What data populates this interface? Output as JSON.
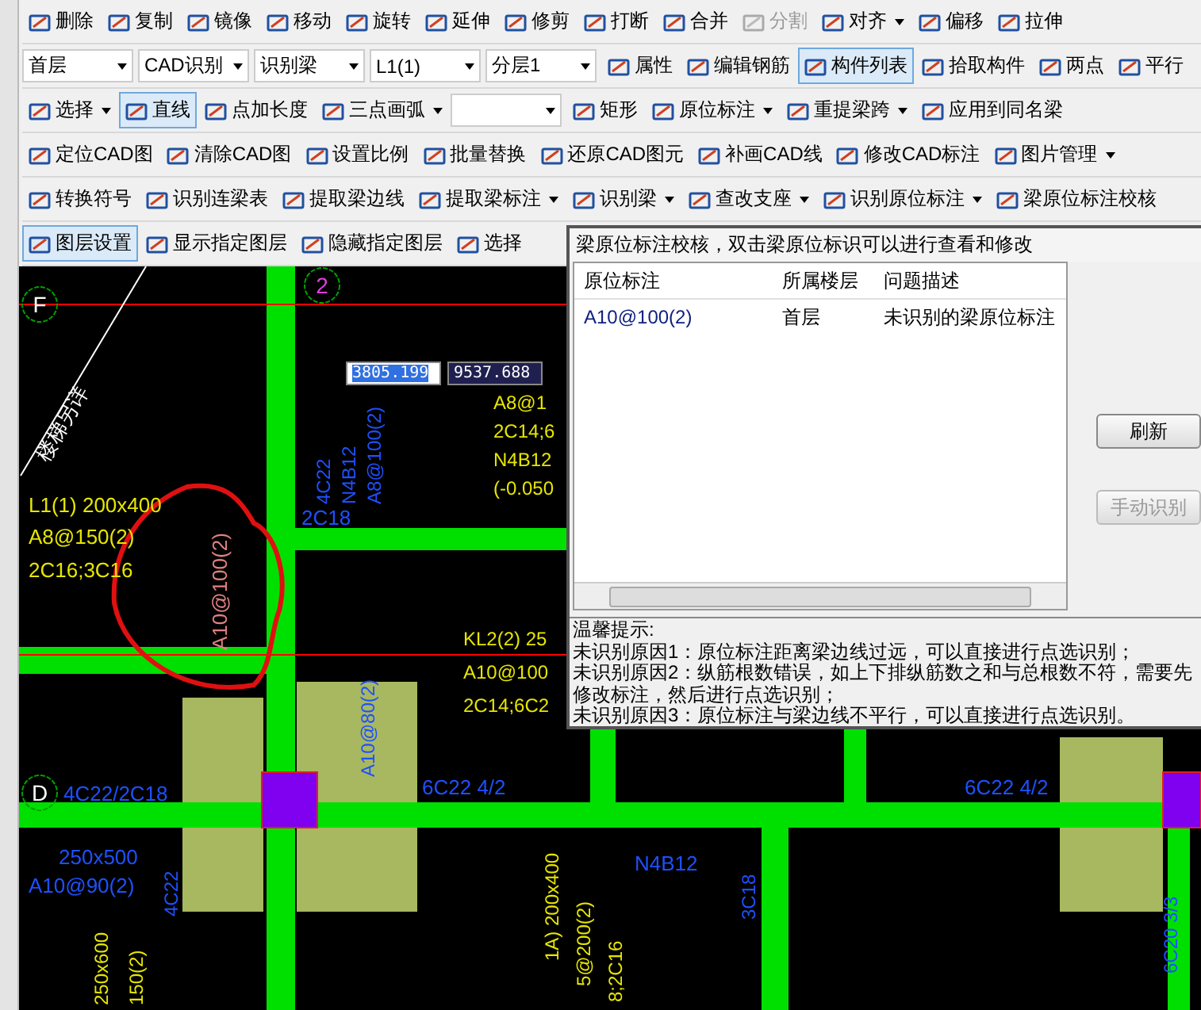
{
  "toolbars": [
    {
      "items": [
        {
          "label": "删除",
          "kind": "button",
          "disabled": false
        },
        {
          "label": "复制",
          "kind": "button",
          "disabled": false
        },
        {
          "label": "镜像",
          "kind": "button",
          "disabled": false
        },
        {
          "label": "移动",
          "kind": "button",
          "disabled": false
        },
        {
          "label": "旋转",
          "kind": "button",
          "disabled": false
        },
        {
          "label": "延伸",
          "kind": "button",
          "disabled": false
        },
        {
          "label": "修剪",
          "kind": "button",
          "disabled": false
        },
        {
          "label": "打断",
          "kind": "button",
          "disabled": false
        },
        {
          "label": "合并",
          "kind": "button",
          "disabled": false
        },
        {
          "label": "分割",
          "kind": "button",
          "disabled": true
        },
        {
          "label": "对齐",
          "kind": "menu",
          "disabled": false
        },
        {
          "label": "偏移",
          "kind": "button",
          "disabled": false
        },
        {
          "label": "拉伸",
          "kind": "button",
          "disabled": false
        }
      ]
    },
    {
      "items": [
        {
          "label": "首层",
          "kind": "combo"
        },
        {
          "label": "CAD识别",
          "kind": "combo"
        },
        {
          "label": "识别梁",
          "kind": "combo"
        },
        {
          "label": "L1(1)",
          "kind": "combo"
        },
        {
          "label": "分层1",
          "kind": "combo"
        },
        {
          "label": "属性",
          "kind": "button",
          "selected": false
        },
        {
          "label": "编辑钢筋",
          "kind": "button",
          "selected": false
        },
        {
          "label": "构件列表",
          "kind": "button",
          "selected": true
        },
        {
          "label": "拾取构件",
          "kind": "button",
          "selected": false
        },
        {
          "label": "两点",
          "kind": "button",
          "selected": false
        },
        {
          "label": "平行",
          "kind": "button",
          "selected": false
        }
      ]
    },
    {
      "items": [
        {
          "label": "选择",
          "kind": "menu",
          "selected": false
        },
        {
          "label": "直线",
          "kind": "button",
          "selected": true
        },
        {
          "label": "点加长度",
          "kind": "button",
          "selected": false
        },
        {
          "label": "三点画弧",
          "kind": "menu",
          "selected": false
        },
        {
          "kind": "combo"
        },
        {
          "label": "矩形",
          "kind": "button",
          "selected": false
        },
        {
          "label": "原位标注",
          "kind": "menu",
          "selected": false
        },
        {
          "label": "重提梁跨",
          "kind": "menu",
          "selected": false
        },
        {
          "label": "应用到同名梁",
          "kind": "button",
          "selected": false
        }
      ]
    },
    {
      "items": [
        {
          "label": "定位CAD图",
          "kind": "button"
        },
        {
          "label": "清除CAD图",
          "kind": "button"
        },
        {
          "label": "设置比例",
          "kind": "button"
        },
        {
          "label": "批量替换",
          "kind": "button"
        },
        {
          "label": "还原CAD图元",
          "kind": "button"
        },
        {
          "label": "补画CAD线",
          "kind": "button"
        },
        {
          "label": "修改CAD标注",
          "kind": "button"
        },
        {
          "label": "图片管理",
          "kind": "menu"
        }
      ]
    },
    {
      "items": [
        {
          "label": "转换符号",
          "kind": "button"
        },
        {
          "label": "识别连梁表",
          "kind": "button"
        },
        {
          "label": "提取梁边线",
          "kind": "button"
        },
        {
          "label": "提取梁标注",
          "kind": "menu"
        },
        {
          "label": "识别梁",
          "kind": "menu"
        },
        {
          "label": "查改支座",
          "kind": "menu"
        },
        {
          "label": "识别原位标注",
          "kind": "menu"
        },
        {
          "label": "梁原位标注校核",
          "kind": "button"
        }
      ]
    },
    {
      "items": [
        {
          "label": "图层设置",
          "kind": "button",
          "selected": true
        },
        {
          "label": "显示指定图层",
          "kind": "button",
          "selected": false
        },
        {
          "label": "隐藏指定图层",
          "kind": "button",
          "selected": false
        },
        {
          "label": "选择",
          "kind": "button",
          "selected": false
        }
      ]
    }
  ],
  "canvas": {
    "axes": [
      {
        "label": "F",
        "color": "#ffffff"
      },
      {
        "label": "2",
        "color": "#e040e0"
      },
      {
        "label": "D",
        "color": "#ffffff"
      }
    ],
    "coordinate_inputs": [
      {
        "value": "3805.199",
        "selected": true
      },
      {
        "value": "9537.688",
        "selected": false
      }
    ],
    "labels": [
      {
        "text": "楼梯另详",
        "color": "#ffffff"
      },
      {
        "text": "L1(1) 200x400",
        "color": "#e6e600"
      },
      {
        "text": "A8@150(2)",
        "color": "#e6e600"
      },
      {
        "text": "2C16;3C16",
        "color": "#e6e600"
      },
      {
        "text": "A10@100(2)",
        "color": "#e08080"
      },
      {
        "text": "4C22",
        "color": "#1e50ff"
      },
      {
        "text": "N4B12",
        "color": "#1e50ff"
      },
      {
        "text": "A8@100(2)",
        "color": "#1e50ff"
      },
      {
        "text": "2C18",
        "color": "#1e50ff"
      },
      {
        "text": "A8@1",
        "color": "#e6e600"
      },
      {
        "text": "2C14;6",
        "color": "#e6e600"
      },
      {
        "text": "N4B12",
        "color": "#e6e600"
      },
      {
        "text": "(-0.050",
        "color": "#e6e600"
      },
      {
        "text": "KL2(2) 25",
        "color": "#e6e600"
      },
      {
        "text": "A10@100",
        "color": "#e6e600"
      },
      {
        "text": "2C14;6C2",
        "color": "#e6e600"
      },
      {
        "text": "A10@80(2)",
        "color": "#1e50ff"
      },
      {
        "text": "4C22/2C18",
        "color": "#1e50ff"
      },
      {
        "text": "6C22 4/2",
        "color": "#1e50ff"
      },
      {
        "text": "6C22 4/2",
        "color": "#1e50ff"
      },
      {
        "text": "250x500",
        "color": "#1e50ff"
      },
      {
        "text": "A10@90(2)",
        "color": "#1e50ff"
      },
      {
        "text": "4C22",
        "color": "#1e50ff"
      },
      {
        "text": "N4B12",
        "color": "#1e50ff"
      },
      {
        "text": "3C18",
        "color": "#1e50ff"
      },
      {
        "text": "6C20 3/3",
        "color": "#1e50ff"
      },
      {
        "text": "250x600",
        "color": "#e6e600"
      },
      {
        "text": "150(2)",
        "color": "#e6e600"
      },
      {
        "text": "1A) 200x400",
        "color": "#e6e600"
      },
      {
        "text": "5@200(2)",
        "color": "#e6e600"
      },
      {
        "text": "8;2C16",
        "color": "#e6e600"
      }
    ]
  },
  "dialog": {
    "title": "梁原位标注校核，双击梁原位标识可以进行查看和修改",
    "columns": [
      "原位标注",
      "所属楼层",
      "问题描述"
    ],
    "rows": [
      [
        "A10@100(2)",
        "首层",
        "未识别的梁原位标注"
      ]
    ],
    "buttons": [
      {
        "label": "刷新",
        "disabled": false
      },
      {
        "label": "手动识别",
        "disabled": true
      }
    ],
    "tips_title": "温馨提示:",
    "tips": [
      "未识别原因1：原位标注距离梁边线过远，可以直接进行点选识别；",
      "未识别原因2：纵筋根数错误，如上下排纵筋数之和与总根数不符，需要先修改标注，然后进行点选识别；",
      "未识别原因3：原位标注与梁边线不平行，可以直接进行点选识别。"
    ]
  }
}
